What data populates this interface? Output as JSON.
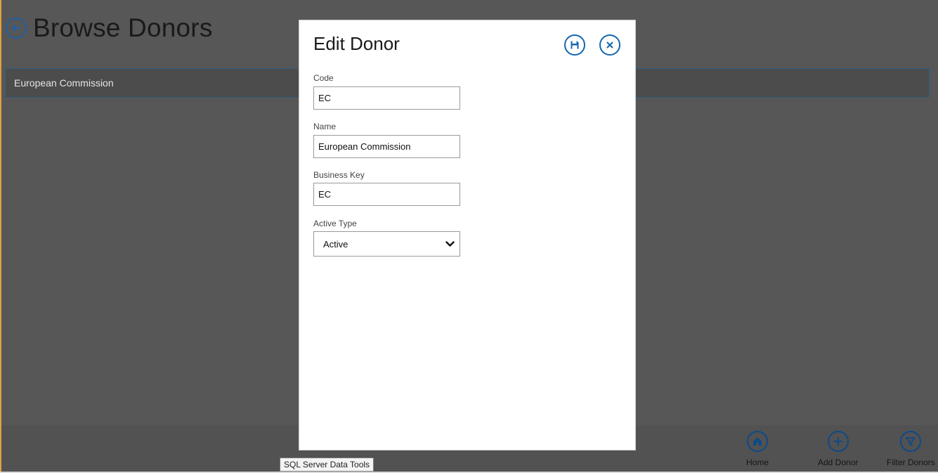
{
  "page": {
    "title": "Browse Donors",
    "back_icon": "back-arrow-icon"
  },
  "donor_list": {
    "items": [
      {
        "label": "European Commission"
      }
    ]
  },
  "dialog": {
    "title": "Edit Donor",
    "save_icon": "save-icon",
    "close_icon": "close-icon",
    "fields": {
      "code": {
        "label": "Code",
        "value": "EC"
      },
      "name": {
        "label": "Name",
        "value": "European Commission"
      },
      "business_key": {
        "label": "Business Key",
        "value": "EC"
      },
      "active_type": {
        "label": "Active Type",
        "value": "Active"
      }
    }
  },
  "appbar": {
    "buttons": [
      {
        "label": "Home",
        "icon": "home-icon"
      },
      {
        "label": "Add Donor",
        "icon": "plus-icon"
      },
      {
        "label": "Filter Donors",
        "icon": "filter-icon"
      }
    ]
  },
  "tooltip": {
    "text": "SQL Server Data Tools"
  },
  "colors": {
    "overlay_background": "#575757",
    "accent_blue": "#1466b0",
    "dialog_background": "#ffffff"
  }
}
